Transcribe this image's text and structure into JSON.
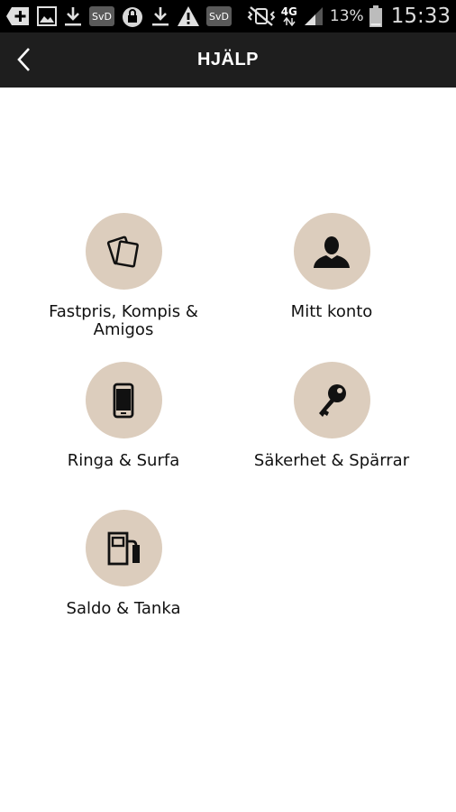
{
  "status_bar": {
    "icons": [
      "add-box-icon",
      "image-icon",
      "download-icon",
      "svd-icon",
      "padlock-icon",
      "download-icon",
      "warning-icon",
      "svd-icon"
    ],
    "svd_label": "SvD",
    "network_label": "4G",
    "battery_percent": "13%",
    "time": "15:33"
  },
  "app_bar": {
    "title": "HJÄLP"
  },
  "menu": {
    "items": [
      {
        "label": "Fastpris, Kompis & Amigos",
        "icon": "cards-icon"
      },
      {
        "label": "Mitt konto",
        "icon": "person-icon"
      },
      {
        "label": "Ringa & Surfa",
        "icon": "phone-icon"
      },
      {
        "label": "Säkerhet & Spärrar",
        "icon": "key-icon"
      },
      {
        "label": "Saldo & Tanka",
        "icon": "fuel-pump-icon"
      }
    ]
  },
  "colors": {
    "status_bar": "#000000",
    "app_bar": "#1e1e1e",
    "circle": "#dccdbd",
    "icon": "#111111",
    "background": "#ffffff"
  }
}
